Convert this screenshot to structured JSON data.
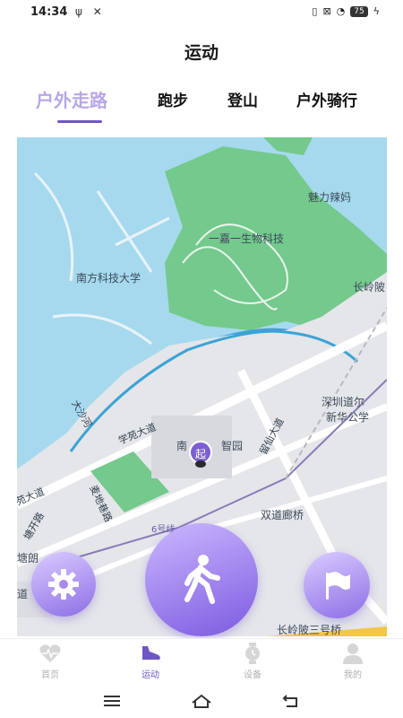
{
  "status_bar": {
    "time": "14:34",
    "battery": "75"
  },
  "page": {
    "title": "运动"
  },
  "tabs": [
    {
      "label": "户外走路",
      "active": true
    },
    {
      "label": "跑步",
      "active": false
    },
    {
      "label": "登山",
      "active": false
    },
    {
      "label": "户外骑行",
      "active": false
    }
  ],
  "map": {
    "labels": {
      "charm": "魅力辣妈",
      "biotech": "一嘉一生物科技",
      "sustech": "南方科技大学",
      "changling": "长岭陂",
      "shenzhen_road": "深圳道尔",
      "xinhua": "新华公学",
      "dashahe": "大沙河",
      "xueyuan_road": "学苑大道",
      "nanzhi": "南",
      "zhiyuan": "智园",
      "liuxian": "留仙大道",
      "maidi": "麦地巷路",
      "yuanxue": "苑大道",
      "shuangdao": "双道廊桥",
      "line6": "6号线",
      "tang": "塘朗",
      "dao": "道",
      "changling_bridge": "长岭陂三号桥",
      "tangxing": "塘开路"
    },
    "start_marker": "起"
  },
  "actions": {
    "settings_icon": "gear-icon",
    "walk_icon": "walking-person-icon",
    "flag_icon": "flag-icon"
  },
  "bottom_nav": [
    {
      "label": "首页",
      "icon": "heart-pulse-icon",
      "active": false
    },
    {
      "label": "运动",
      "icon": "shoe-icon",
      "active": true
    },
    {
      "label": "设备",
      "icon": "watch-icon",
      "active": false
    },
    {
      "label": "我的",
      "icon": "person-icon",
      "active": false
    }
  ],
  "colors": {
    "accent": "#6e56c7",
    "tab_active": "#b8a6e8",
    "map_water": "#a6d9ee",
    "map_green": "#74c98c"
  }
}
